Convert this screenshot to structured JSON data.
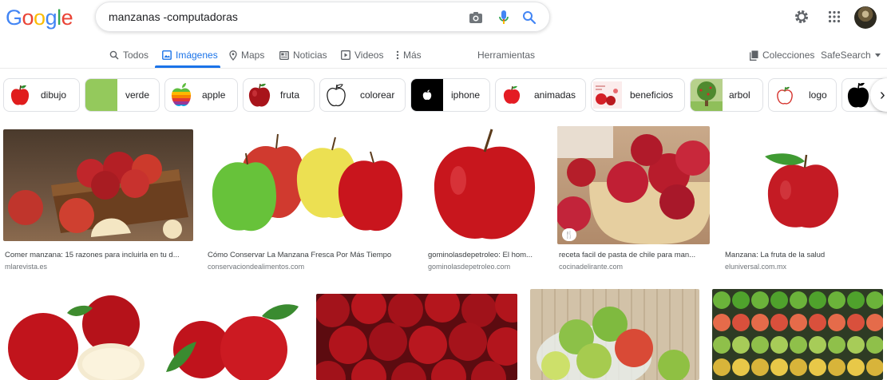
{
  "logo": {
    "letters": [
      "G",
      "o",
      "o",
      "g",
      "l",
      "e"
    ],
    "colors": [
      "#4285f4",
      "#ea4335",
      "#fbbc05",
      "#4285f4",
      "#34a853",
      "#ea4335"
    ]
  },
  "search": {
    "query": "manzanas -computadoras",
    "icons": [
      "camera-icon",
      "microphone-icon",
      "search-icon"
    ]
  },
  "header_icons": [
    "gear-icon",
    "apps-grid-icon",
    "account-avatar"
  ],
  "tabs": [
    {
      "label": "Todos",
      "icon": "search-icon",
      "active": false
    },
    {
      "label": "Imágenes",
      "icon": "image-icon",
      "active": true
    },
    {
      "label": "Maps",
      "icon": "map-pin-icon",
      "active": false
    },
    {
      "label": "Noticias",
      "icon": "newspaper-icon",
      "active": false
    },
    {
      "label": "Videos",
      "icon": "play-icon",
      "active": false
    },
    {
      "label": "Más",
      "icon": "more-vertical-icon",
      "active": false
    }
  ],
  "tools_label": "Herramientas",
  "collections_label": "Colecciones",
  "safesearch_label": "SafeSearch",
  "chips": [
    "dibujo",
    "verde",
    "apple",
    "fruta",
    "colorear",
    "iphone",
    "animadas",
    "beneficios",
    "arbol",
    "logo"
  ],
  "results": [
    {
      "title": "Comer manzana: 15 razones para incluirla en tu d...",
      "site": "mlarevista.es"
    },
    {
      "title": "Cómo Conservar La Manzana Fresca Por Más Tiempo",
      "site": "conservaciondealimentos.com"
    },
    {
      "title": "gominolasdepetroleo: El hom...",
      "site": "gominolasdepetroleo.com"
    },
    {
      "title": "receta facil de pasta de chile para man...",
      "site": "cocinadelirante.com"
    },
    {
      "title": "Manzana: La fruta de la salud",
      "site": "eluniversal.com.mx"
    }
  ],
  "colors": {
    "accent": "#1a73e8",
    "text_secondary": "#5f6368",
    "apple_red": "#c8161d"
  }
}
